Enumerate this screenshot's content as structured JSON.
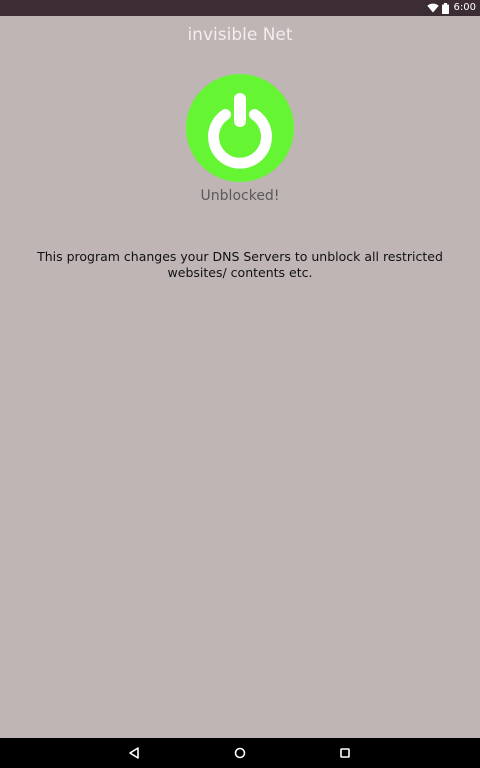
{
  "status_bar": {
    "time": "6:00",
    "icons": [
      "wifi-icon",
      "battery-icon"
    ]
  },
  "app": {
    "title": "invisible Net"
  },
  "power": {
    "icon": "power-icon",
    "state_text": "Unblocked!",
    "color": "#66f533"
  },
  "description": "This program changes your DNS Servers to unblock all restricted websites/ contents etc.",
  "navigation": {
    "buttons": [
      "back-icon",
      "home-icon",
      "recents-icon"
    ]
  }
}
